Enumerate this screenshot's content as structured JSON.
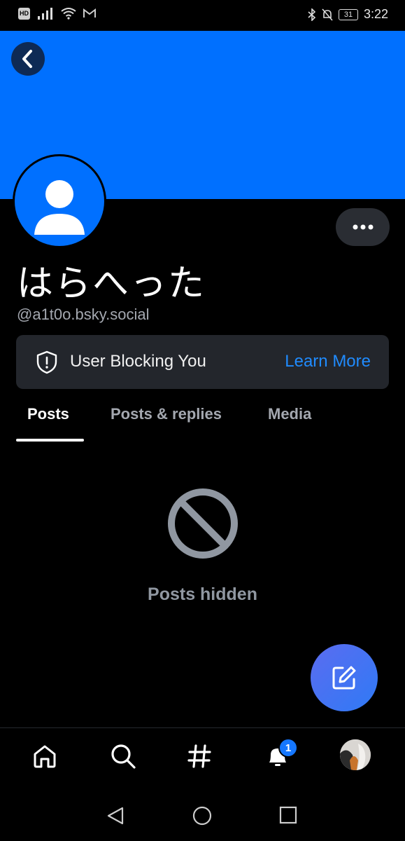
{
  "status_bar": {
    "hd_badge": "HD",
    "battery": "31",
    "time": "3:22"
  },
  "profile": {
    "display_name": "はらへった",
    "handle": "@a1t0o.bsky.social"
  },
  "block_notice": {
    "text": "User Blocking You",
    "link": "Learn More"
  },
  "tabs": [
    {
      "label": "Posts",
      "active": true
    },
    {
      "label": "Posts & replies",
      "active": false
    },
    {
      "label": "Media",
      "active": false
    }
  ],
  "feed": {
    "empty_message": "Posts hidden"
  },
  "bottom_nav": {
    "items": [
      "home-icon",
      "search-icon",
      "hashtag-icon",
      "notifications-icon",
      "profile-avatar"
    ],
    "notification_count": "1"
  },
  "colors": {
    "banner": "#0070ff",
    "accent": "#208bfe",
    "background": "#000000"
  }
}
